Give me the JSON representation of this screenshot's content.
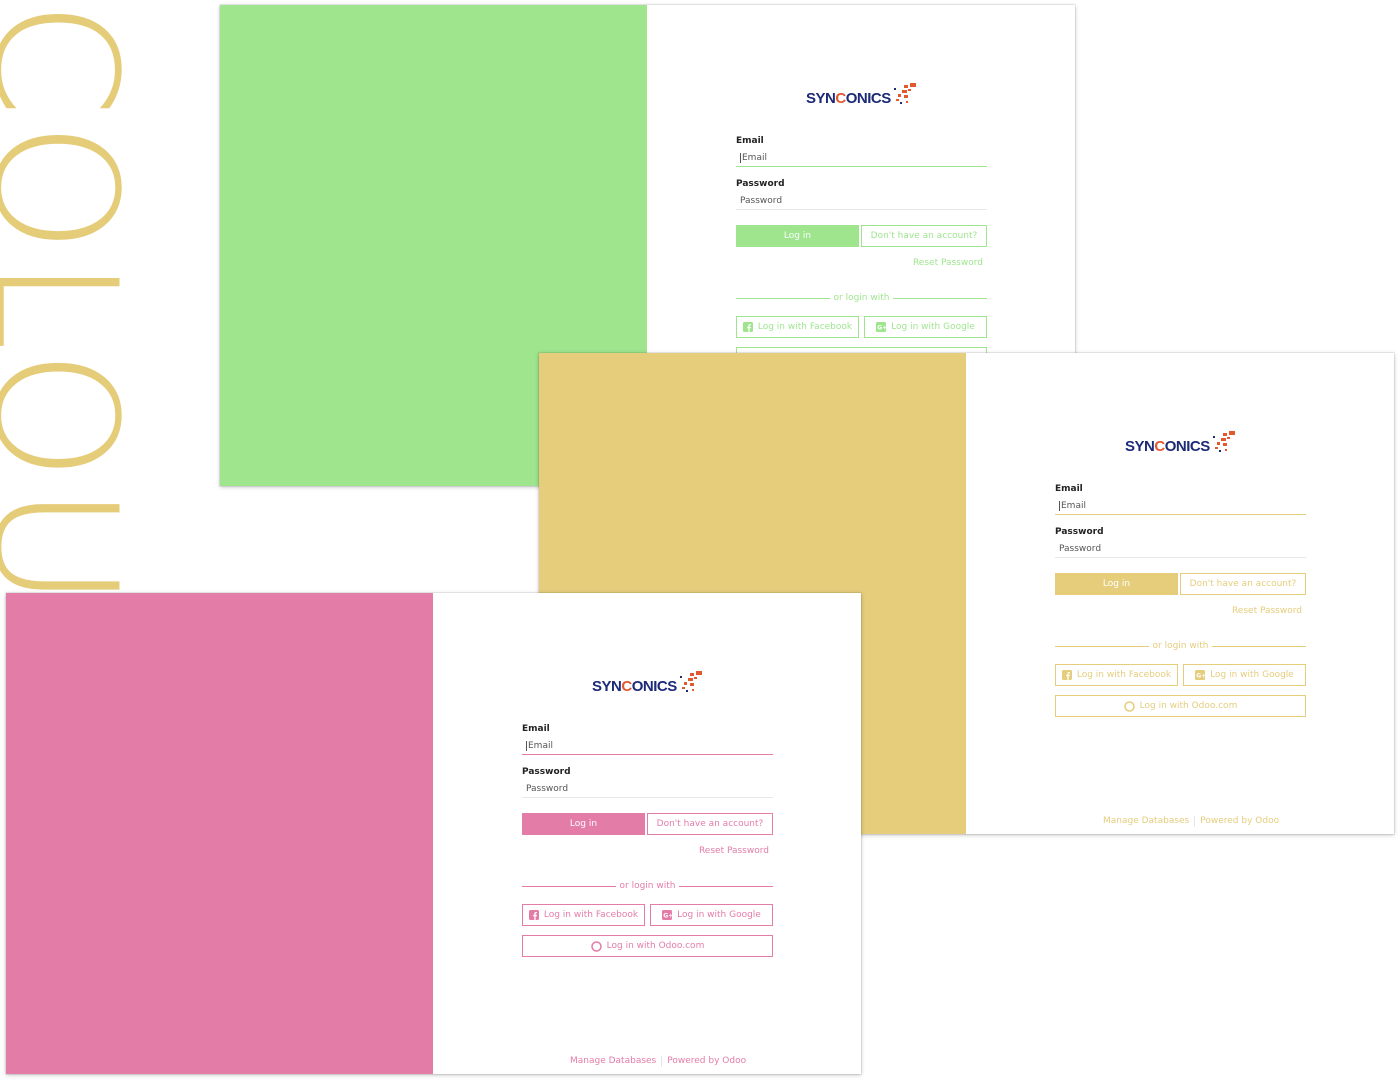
{
  "watermark": {
    "text": "COLOUR",
    "color": "#e5cc79"
  },
  "brand": {
    "syn": "SYN",
    "c": "C",
    "onics": "ONICS"
  },
  "labels": {
    "email": "Email",
    "email_placeholder": "Email",
    "password": "Password",
    "password_placeholder": "Password",
    "login": "Log in",
    "signup": "Don't have an account?",
    "reset": "Reset Password",
    "or_login_with": "or login with",
    "facebook": "Log in with Facebook",
    "google": "Log in with Google",
    "odoo": "Log in with Odoo.com",
    "manage_databases": "Manage Databases",
    "powered_by": "Powered by Odoo"
  },
  "themes": {
    "green": {
      "accent": "#9ee58e"
    },
    "yellow": {
      "accent": "#e5cd7c"
    },
    "pink": {
      "accent": "#e47ca8"
    }
  },
  "icons": [
    "facebook-icon",
    "google-plus-icon",
    "odoo-circle-icon",
    "synconics-logo-mark"
  ]
}
